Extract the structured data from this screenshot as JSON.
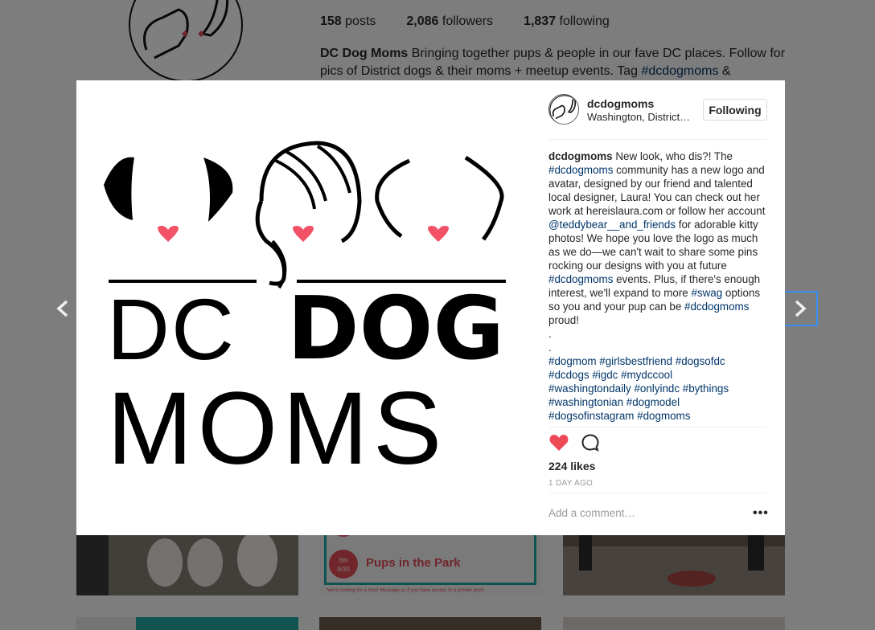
{
  "profile": {
    "stats": {
      "posts_count": "158",
      "posts_label": "posts",
      "followers_count": "2,086",
      "followers_label": "followers",
      "following_count": "1,837",
      "following_label": "following"
    },
    "bio_name": "DC Dog Moms",
    "bio_text": " Bringing together pups & people in our fave DC places. Follow for pics of District dogs & their moms + meetup events. Tag ",
    "bio_tag": "#dcdogmoms",
    "bio_end": " &"
  },
  "background_tiles": {
    "event_label": "Pups in the Park",
    "event_date_top": "6th",
    "event_date_bottom": "9/30",
    "event_footnote": "*we're looking for a host! Message us if you have access to a private pool!"
  },
  "post": {
    "logo": {
      "line1_light": "DC",
      "line1_bold": "DOG",
      "line2": "MOMS"
    },
    "username": "dcdogmoms",
    "location": "Washington, District of Columbia",
    "follow_label": "Following",
    "caption_username": "dcdogmoms",
    "caption_parts": {
      "p1": " New look, who dis?! The ",
      "tag1": "#dcdogmoms",
      "p2": " community has a new logo and avatar, designed by our friend and talented local designer, Laura! You can check out her work at hereislaura.com or follow her account ",
      "mention": "@teddybear__and_friends",
      "p3": " for adorable kitty photos! We hope you love the logo as much as we do—we can't wait to share some pins rocking our designs with you at future ",
      "tag2": "#dcdogmoms",
      "p4": " events. Plus, if there's enough interest, we'll expand to more ",
      "tag3": "#swag",
      "p5": " options so you and your pup can be ",
      "tag4": "#dcdogmoms",
      "p6": " proud!",
      "dot1": ".",
      "dot2": ".",
      "hashtags_line1": "#dogmom #girlsbestfriend #dogsofdc",
      "hashtags_line2": "#dcdogs #igdc #mydccool",
      "hashtags_line3": "#washingtondaily #onlyindc #bythings",
      "hashtags_line4": "#washingtonian #dogmodel",
      "hashtags_line5": "#dogsofinstagram #dogmoms"
    },
    "likes": "224 likes",
    "timestamp": "1 DAY AGO",
    "comment_placeholder": "Add a comment…",
    "more_label": "•••"
  },
  "nav": {
    "prev_label": "❮",
    "next_label": "❯"
  },
  "colors": {
    "heart": "#ed4956",
    "hashtag": "#003569",
    "focus_ring": "#3b8ef0"
  }
}
